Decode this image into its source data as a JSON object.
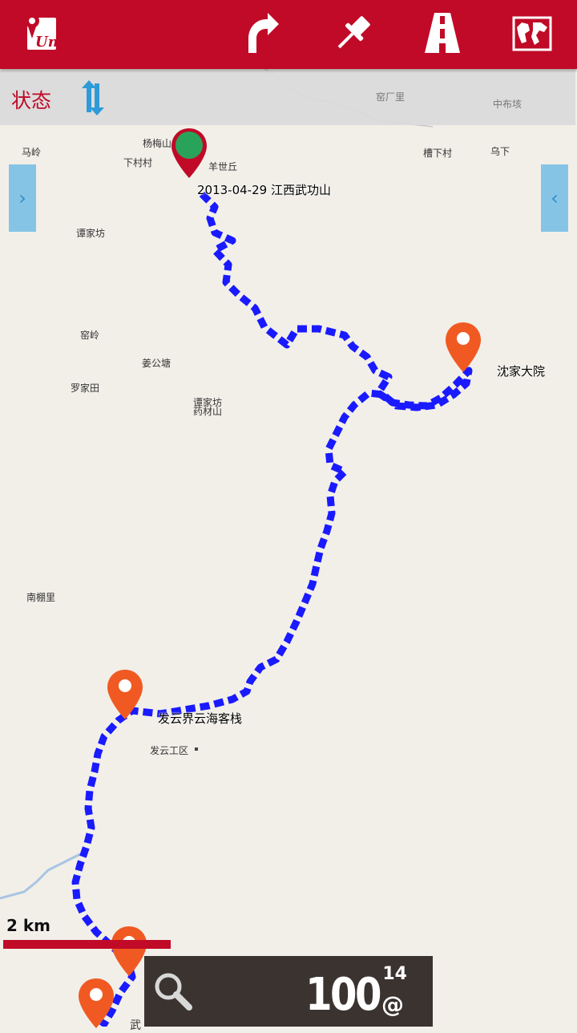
{
  "toolbar": {
    "logo_text": "Un",
    "buttons": [
      "turn-arrow-icon",
      "pushpin-icon",
      "road-icon",
      "world-map-icon"
    ]
  },
  "status": {
    "label": "状态"
  },
  "side_tabs": {
    "left": "›",
    "right": "‹"
  },
  "map_places": [
    {
      "id": "place-maling",
      "text": "马岭"
    },
    {
      "id": "place-yangmeishan",
      "text": "杨梅山"
    },
    {
      "id": "place-xiacuncun",
      "text": "下村村"
    },
    {
      "id": "place-yangshiqiu",
      "text": "羊世丘"
    },
    {
      "id": "place-yaochangli",
      "text": "窑厂里"
    },
    {
      "id": "place-zhongbuling",
      "text": "中布垓"
    },
    {
      "id": "place-caoxiacun",
      "text": "槽下村"
    },
    {
      "id": "place-wuxia",
      "text": "乌下"
    },
    {
      "id": "place-tanjiafang",
      "text": "谭家坊"
    },
    {
      "id": "place-yaoling",
      "text": "窑岭"
    },
    {
      "id": "place-janggongtang",
      "text": "姜公塘"
    },
    {
      "id": "place-luojiatian",
      "text": "罗家田"
    },
    {
      "id": "place-tanjiafang2",
      "text": "谭家坊"
    },
    {
      "id": "place-yaocaishan",
      "text": "药材山"
    },
    {
      "id": "place-nanpengli",
      "text": "南棚里"
    },
    {
      "id": "place-fayungongqu",
      "text": "发云工区"
    },
    {
      "id": "place-wu",
      "text": "武"
    }
  ],
  "markers": {
    "start_label": "2013-04-29 江西武功山",
    "shenjia_label": "沈家大院",
    "fayun_label": "发云界云海客栈"
  },
  "scale": {
    "text": "2 km"
  },
  "zoom_panel": {
    "value": "100",
    "level": "14",
    "at": "@"
  },
  "colors": {
    "accent": "#c00a27",
    "track": "#1a1aff",
    "pin_orange": "#f05a22",
    "pin_start": "#2aa35a"
  }
}
